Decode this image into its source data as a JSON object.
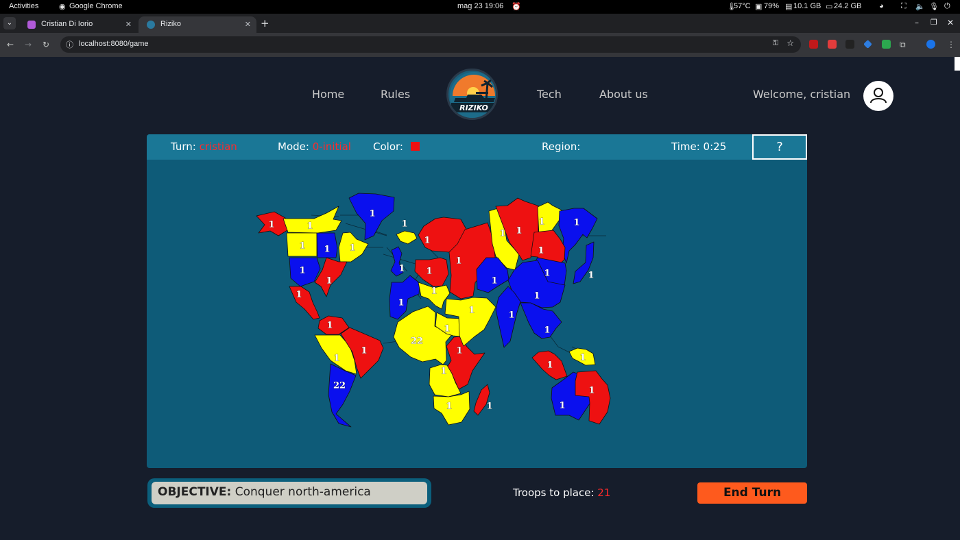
{
  "os_bar": {
    "activities": "Activities",
    "app_name": "Google Chrome",
    "datetime": "mag 23  19:06",
    "temp": "57°C",
    "battery": "79%",
    "memory": "10.1 GB",
    "disk": "24.2 GB"
  },
  "browser": {
    "tabs": [
      {
        "title": "Cristian Di Iorio",
        "active": false
      },
      {
        "title": "Riziko",
        "active": true
      }
    ],
    "url": "localhost:8080/game"
  },
  "nav": {
    "links": [
      "Home",
      "Rules",
      "Tech",
      "About us"
    ],
    "logo_text": "RIZIKO",
    "welcome": "Welcome, cristian"
  },
  "hud": {
    "turn_label": "Turn:",
    "turn_value": "cristian",
    "mode_label": "Mode:",
    "mode_value": "0-initial",
    "color_label": "Color:",
    "color_value": "#ee1111",
    "region_label": "Region:",
    "region_value": "",
    "time_label": "Time:",
    "time_value": "0:25",
    "help": "?"
  },
  "objective": {
    "label": "OBJECTIVE:",
    "text": "Conquer north-america"
  },
  "troops": {
    "label": "Troops to place:",
    "value": "21"
  },
  "end_turn": "End Turn",
  "colors": {
    "red": "#ee1111",
    "yellow": "#ffff00",
    "blue": "#0a10ee",
    "accent_orange": "#fe5a1d"
  },
  "territories": [
    {
      "name": "alaska",
      "owner": "red",
      "troops": "1"
    },
    {
      "name": "northwest-territory",
      "owner": "yellow",
      "troops": "1"
    },
    {
      "name": "greenland",
      "owner": "blue",
      "troops": "1"
    },
    {
      "name": "alberta",
      "owner": "yellow",
      "troops": "1"
    },
    {
      "name": "ontario",
      "owner": "blue",
      "troops": "1"
    },
    {
      "name": "quebec",
      "owner": "yellow",
      "troops": "1"
    },
    {
      "name": "western-us",
      "owner": "blue",
      "troops": "1"
    },
    {
      "name": "eastern-us",
      "owner": "red",
      "troops": "1"
    },
    {
      "name": "central-america",
      "owner": "red",
      "troops": "1"
    },
    {
      "name": "venezuela",
      "owner": "red",
      "troops": "1"
    },
    {
      "name": "peru",
      "owner": "yellow",
      "troops": "1"
    },
    {
      "name": "brazil",
      "owner": "red",
      "troops": "1"
    },
    {
      "name": "argentina",
      "owner": "blue",
      "troops": "22"
    },
    {
      "name": "iceland",
      "owner": "yellow",
      "troops": "1"
    },
    {
      "name": "great-britain",
      "owner": "blue",
      "troops": "1"
    },
    {
      "name": "scandinavia",
      "owner": "red",
      "troops": "1"
    },
    {
      "name": "northern-europe",
      "owner": "red",
      "troops": "1"
    },
    {
      "name": "western-europe",
      "owner": "blue",
      "troops": "1"
    },
    {
      "name": "southern-europe",
      "owner": "yellow",
      "troops": "1"
    },
    {
      "name": "ukraine",
      "owner": "red",
      "troops": "1"
    },
    {
      "name": "north-africa",
      "owner": "yellow",
      "troops": "22"
    },
    {
      "name": "egypt",
      "owner": "yellow",
      "troops": "1"
    },
    {
      "name": "east-africa",
      "owner": "red",
      "troops": "1"
    },
    {
      "name": "congo",
      "owner": "yellow",
      "troops": "1"
    },
    {
      "name": "south-africa",
      "owner": "yellow",
      "troops": "1"
    },
    {
      "name": "madagascar",
      "owner": "red",
      "troops": "1"
    },
    {
      "name": "ural",
      "owner": "yellow",
      "troops": "1"
    },
    {
      "name": "siberia",
      "owner": "red",
      "troops": "1"
    },
    {
      "name": "yakutsk",
      "owner": "yellow",
      "troops": "1"
    },
    {
      "name": "kamchatka",
      "owner": "blue",
      "troops": "1"
    },
    {
      "name": "irkutsk",
      "owner": "red",
      "troops": "1"
    },
    {
      "name": "afghanistan",
      "owner": "blue",
      "troops": "1"
    },
    {
      "name": "mongolia",
      "owner": "blue",
      "troops": "1"
    },
    {
      "name": "japan",
      "owner": "blue",
      "troops": "1"
    },
    {
      "name": "china",
      "owner": "blue",
      "troops": "1"
    },
    {
      "name": "middle-east",
      "owner": "yellow",
      "troops": "1"
    },
    {
      "name": "india",
      "owner": "blue",
      "troops": "1"
    },
    {
      "name": "siam",
      "owner": "blue",
      "troops": "1"
    },
    {
      "name": "indonesia",
      "owner": "red",
      "troops": "1"
    },
    {
      "name": "new-guinea",
      "owner": "yellow",
      "troops": "1"
    },
    {
      "name": "western-australia",
      "owner": "blue",
      "troops": "1"
    },
    {
      "name": "eastern-australia",
      "owner": "red",
      "troops": "1"
    }
  ]
}
